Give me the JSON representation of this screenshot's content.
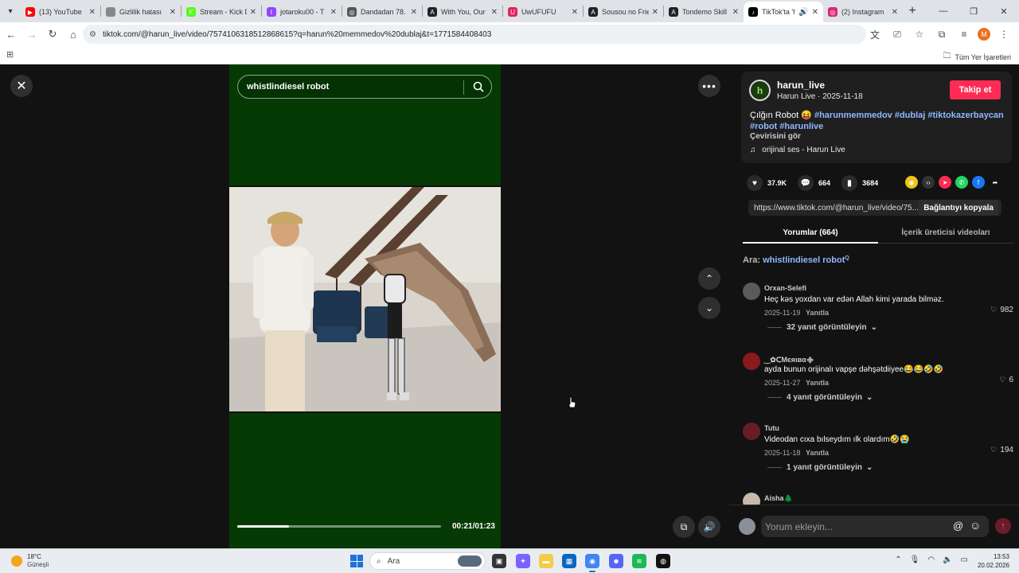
{
  "browser": {
    "tabs": [
      {
        "title": "(13) YouTube",
        "color": "#ff0000",
        "glyph": "▶"
      },
      {
        "title": "Gizlilik hatası",
        "color": "#888888",
        "glyph": ""
      },
      {
        "title": "Stream - Kick D",
        "color": "#53fc18",
        "glyph": "K"
      },
      {
        "title": "jotaroku00 - T",
        "color": "#9146ff",
        "glyph": "t"
      },
      {
        "title": "Dandadan 78.",
        "color": "#555555",
        "glyph": "◎"
      },
      {
        "title": "With You, Our",
        "color": "#222222",
        "glyph": "A"
      },
      {
        "title": "UwUFUFU",
        "color": "#e0245e",
        "glyph": "U"
      },
      {
        "title": "Sousou no Frie",
        "color": "#222222",
        "glyph": "A"
      },
      {
        "title": "Tondemo Skill",
        "color": "#222222",
        "glyph": "A"
      },
      {
        "title": "TikTok'ta 'h",
        "color": "#000000",
        "glyph": "♪",
        "active": true
      },
      {
        "title": "(2) Instagram",
        "color": "#d62976",
        "glyph": "◎"
      }
    ],
    "url": "tiktok.com/@harun_live/video/7574106318512868615?q=harun%20memmedov%20dublaj&t=1771584408403",
    "profile_initial": "M",
    "bookmarks_all": "Tüm Yer İşaretleri"
  },
  "video": {
    "search_text": "whistlindiesel robot",
    "time": "00:21/01:23",
    "progress_fraction": 0.255
  },
  "info": {
    "username": "harun_live",
    "subline": "Harun Live · 2025-11-18",
    "follow_label": "Takip et",
    "caption_text": "Çılğın Robot 😝",
    "hashtags_line1": "#harunmemmedov #dublaj #tiktokazerbaycan",
    "hashtags_line2": "#robot #harunlive",
    "translate": "Çevirisini gör",
    "music": "orijinal ses - Harun Live"
  },
  "stats": {
    "likes": "37.9K",
    "comments": "664",
    "saves": "3684"
  },
  "link": {
    "url": "https://www.tiktok.com/@harun_live/video/75...",
    "copy_label": "Bağlantıyı kopyala"
  },
  "tabs": {
    "comments_label": "Yorumlar (664)",
    "creator_label": "İçerik üreticisi videoları"
  },
  "search_hint": {
    "prefix": "Ara:",
    "query": "whistlindiesel robot"
  },
  "comments": [
    {
      "user": "Orxan-Selefi",
      "text": "Heç kəs yoxdan var edən Allah kimi yarada bilməz.",
      "date": "2025-11-19",
      "reply": "Yanıtla",
      "likes": "982",
      "more": "32 yanıt görüntüleyin",
      "avatar": "#5a5a5a"
    },
    {
      "user": "‿✿ᑕMєяιвα᯽",
      "text": "ayda bunun orijinalı vapşe dəhşətdiiyee😂😂🤣🤣",
      "date": "2025-11-27",
      "reply": "Yanıtla",
      "likes": "6",
      "more": "4 yanıt görüntüleyin",
      "avatar": "#8b1a1a"
    },
    {
      "user": "Tutu",
      "text": "Videodan cıxa bılseydım ılk olardım🤣😭",
      "date": "2025-11-18",
      "reply": "Yanıtla",
      "likes": "194",
      "more": "1 yanıt görüntüleyin",
      "avatar": "#6a1b2a"
    },
    {
      "user": "Aisha🌲",
      "text": "",
      "date": "",
      "reply": "",
      "likes": "",
      "more": "",
      "avatar": "#c8b8a8"
    }
  ],
  "add_comment": {
    "placeholder": "Yorum ekleyin..."
  },
  "taskbar": {
    "temp": "18°C",
    "weather": "Güneşli",
    "search_label": "Ara",
    "time": "13:53",
    "date": "20.02.2026"
  }
}
